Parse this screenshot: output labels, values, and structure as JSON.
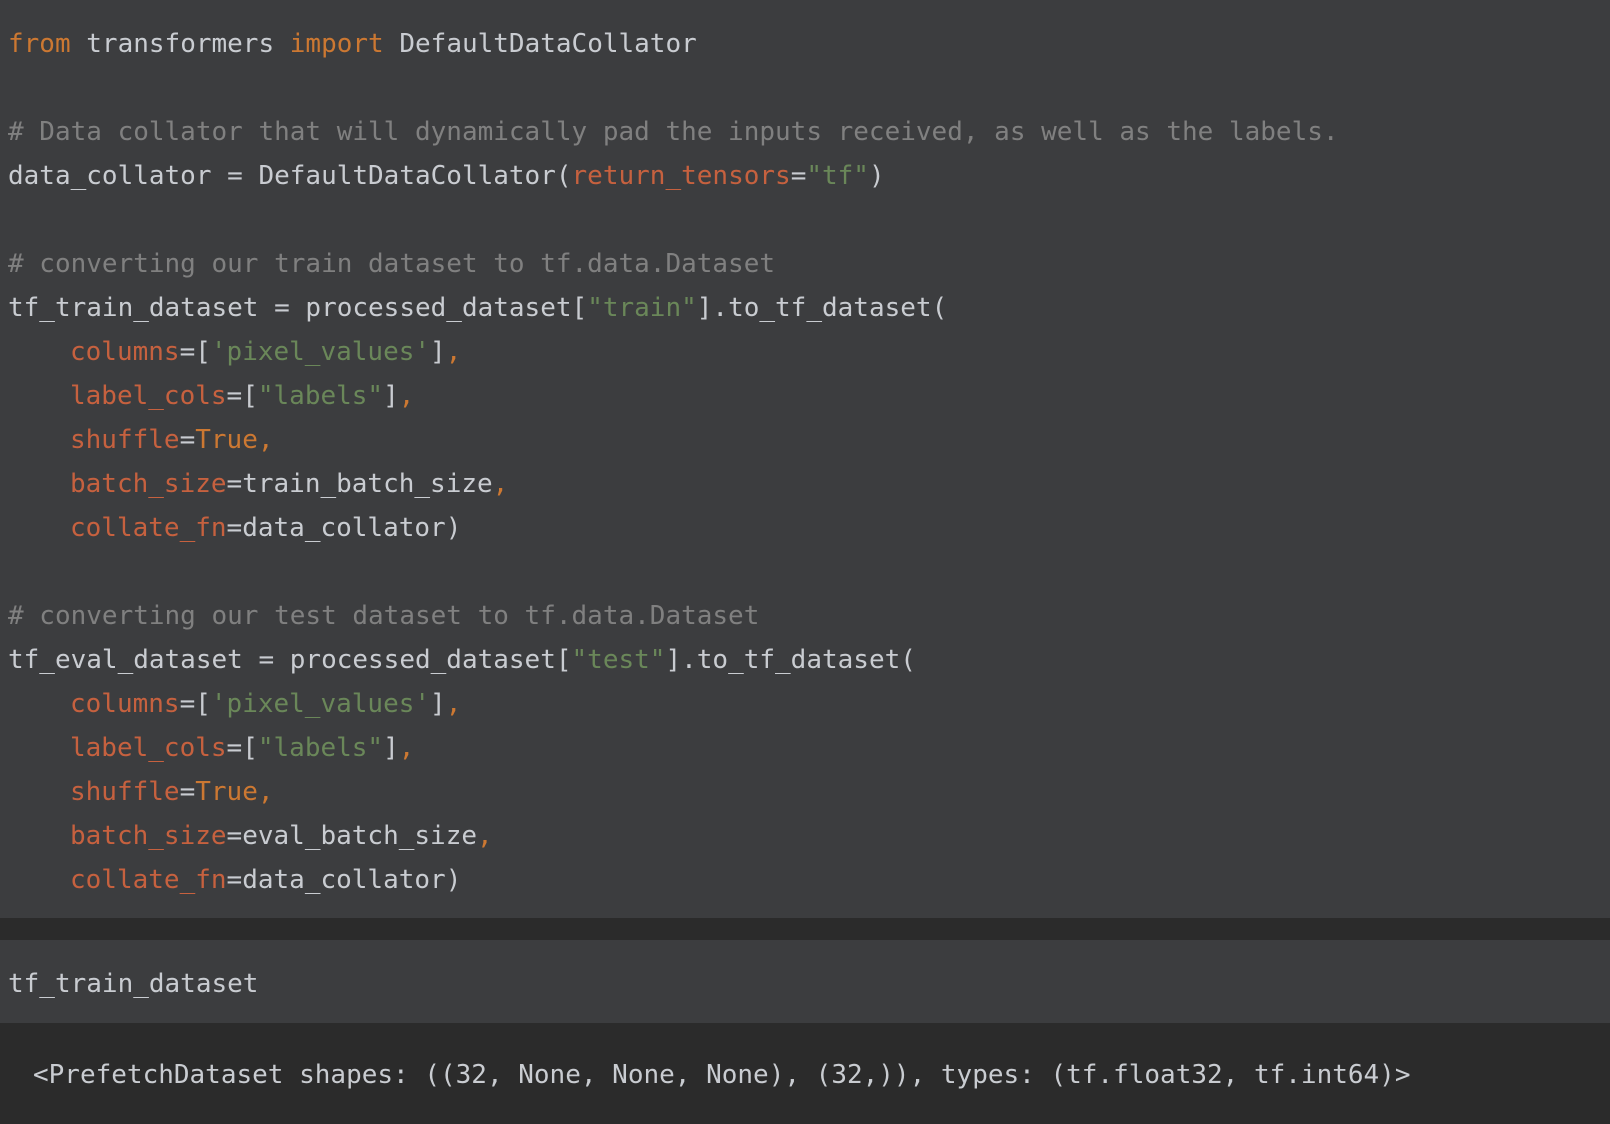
{
  "cell1": {
    "l1": {
      "kw_from": "from",
      "mod": " transformers ",
      "kw_import": "import",
      "name": " DefaultDataCollator"
    },
    "l3": {
      "comment": "# Data collator that will dynamically pad the inputs received, as well as the labels."
    },
    "l4": {
      "a": "data_collator = DefaultDataCollator(",
      "param": "return_tensors",
      "eq": "=",
      "str": "\"tf\"",
      "close": ")"
    },
    "l6": {
      "comment": "# converting our train dataset to tf.data.Dataset"
    },
    "l7": {
      "a": "tf_train_dataset = processed_dataset[",
      "str": "\"train\"",
      "b": "].to_tf_dataset("
    },
    "l8": {
      "param": "columns",
      "a": "=[",
      "str": "'pixel_values'",
      "b": "]",
      "comma": ","
    },
    "l9": {
      "param": "label_cols",
      "a": "=[",
      "str": "\"labels\"",
      "b": "]",
      "comma": ","
    },
    "l10": {
      "param": "shuffle",
      "eq": "=",
      "val": "True",
      "comma": ","
    },
    "l11": {
      "param": "batch_size",
      "eq": "=",
      "val": "train_batch_size",
      "comma": ","
    },
    "l12": {
      "param": "collate_fn",
      "eq": "=",
      "val": "data_collator)"
    },
    "l14": {
      "comment": "# converting our test dataset to tf.data.Dataset"
    },
    "l15": {
      "a": "tf_eval_dataset = processed_dataset[",
      "str": "\"test\"",
      "b": "].to_tf_dataset("
    },
    "l16": {
      "param": "columns",
      "a": "=[",
      "str": "'pixel_values'",
      "b": "]",
      "comma": ","
    },
    "l17": {
      "param": "label_cols",
      "a": "=[",
      "str": "\"labels\"",
      "b": "]",
      "comma": ","
    },
    "l18": {
      "param": "shuffle",
      "eq": "=",
      "val": "True",
      "comma": ","
    },
    "l19": {
      "param": "batch_size",
      "eq": "=",
      "val": "eval_batch_size",
      "comma": ","
    },
    "l20": {
      "param": "collate_fn",
      "eq": "=",
      "val": "data_collator)"
    }
  },
  "cell2": {
    "code": "tf_train_dataset"
  },
  "output": {
    "text": "<PrefetchDataset shapes: ((32, None, None, None), (32,)), types: (tf.float32, tf.int64)>"
  }
}
